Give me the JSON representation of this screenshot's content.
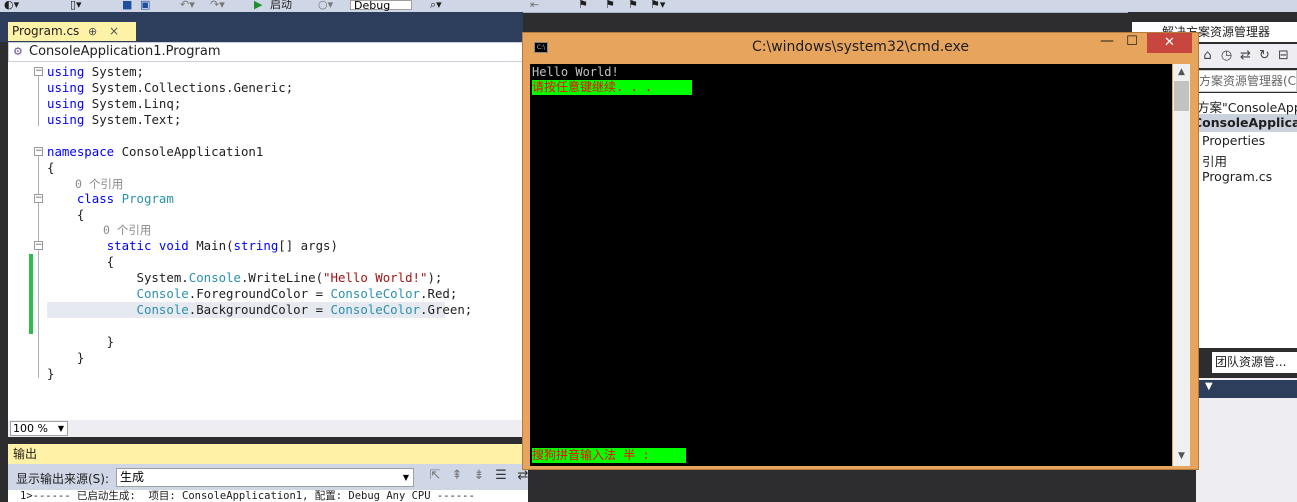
{
  "toolbar": {
    "run_label": "启动",
    "config_value": "Debug"
  },
  "editor": {
    "tab_label": "Program.cs",
    "tab_pin": "⊕",
    "tab_close": "×",
    "nav_class": "ConsoleApplication1.Program",
    "ref_ns_program": "0 个引用",
    "ref_main": "0 个引用",
    "zoom": "100 %"
  },
  "output": {
    "title": "输出",
    "source_label": "显示输出来源(S):",
    "source_value": "生成",
    "text": "1>------ 已启动生成:  项目: ConsoleApplication1, 配置: Debug Any CPU ------"
  },
  "solution_explorer": {
    "title": "解决方案资源管理器",
    "search_placeholder": "方案资源管理器(Ctrl-",
    "tree": [
      "方案\"ConsoleAppli",
      "ConsoleApplicatio",
      "Properties",
      "引用",
      "Program.cs"
    ],
    "team_tab": "团队资源管..."
  },
  "cmd": {
    "title": "C:\\windows\\system32\\cmd.exe",
    "lines": {
      "hello": "Hello World!",
      "press_key": "请按任意键继续. . .",
      "ime": "搜狗拼音输入法 半 :"
    }
  },
  "colors": {
    "cmd_title_bar": "#e6a45c",
    "cmd_close": "#c7473e",
    "console_bg": "#000000",
    "console_fg_red": "#ff0000",
    "console_bg_green": "#00ff00",
    "vs_tab_active": "#fff1a6",
    "vs_chrome": "#2d3e5c"
  }
}
